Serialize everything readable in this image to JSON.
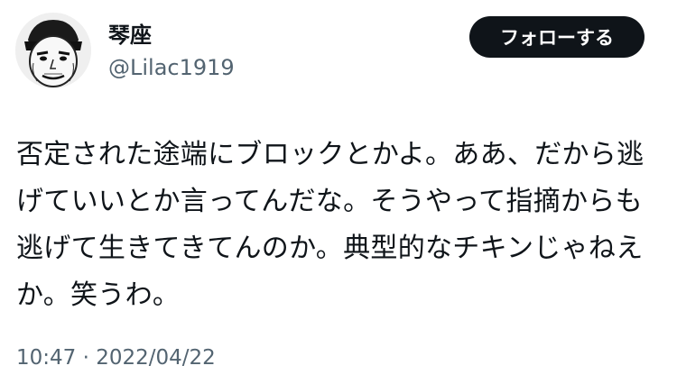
{
  "user": {
    "display_name": "琴座",
    "handle": "@Lilac1919",
    "avatar_icon": "manga-face-avatar"
  },
  "actions": {
    "follow_label": "フォローする"
  },
  "tweet": {
    "lines": [
      "否定された途端にブロックとかよ。ああ、だから逃",
      "げていいとか言ってんだな。そうやって指摘からも",
      "逃げて生きてきてんのか。典型的なチキンじゃねえ",
      "か。笑うわ。"
    ],
    "timestamp": "10:47 · 2022/04/22"
  },
  "colors": {
    "text": "#0f1419",
    "secondary_text": "#536471",
    "follow_button_bg": "#0f1419",
    "follow_button_text": "#ffffff",
    "background": "#ffffff"
  }
}
